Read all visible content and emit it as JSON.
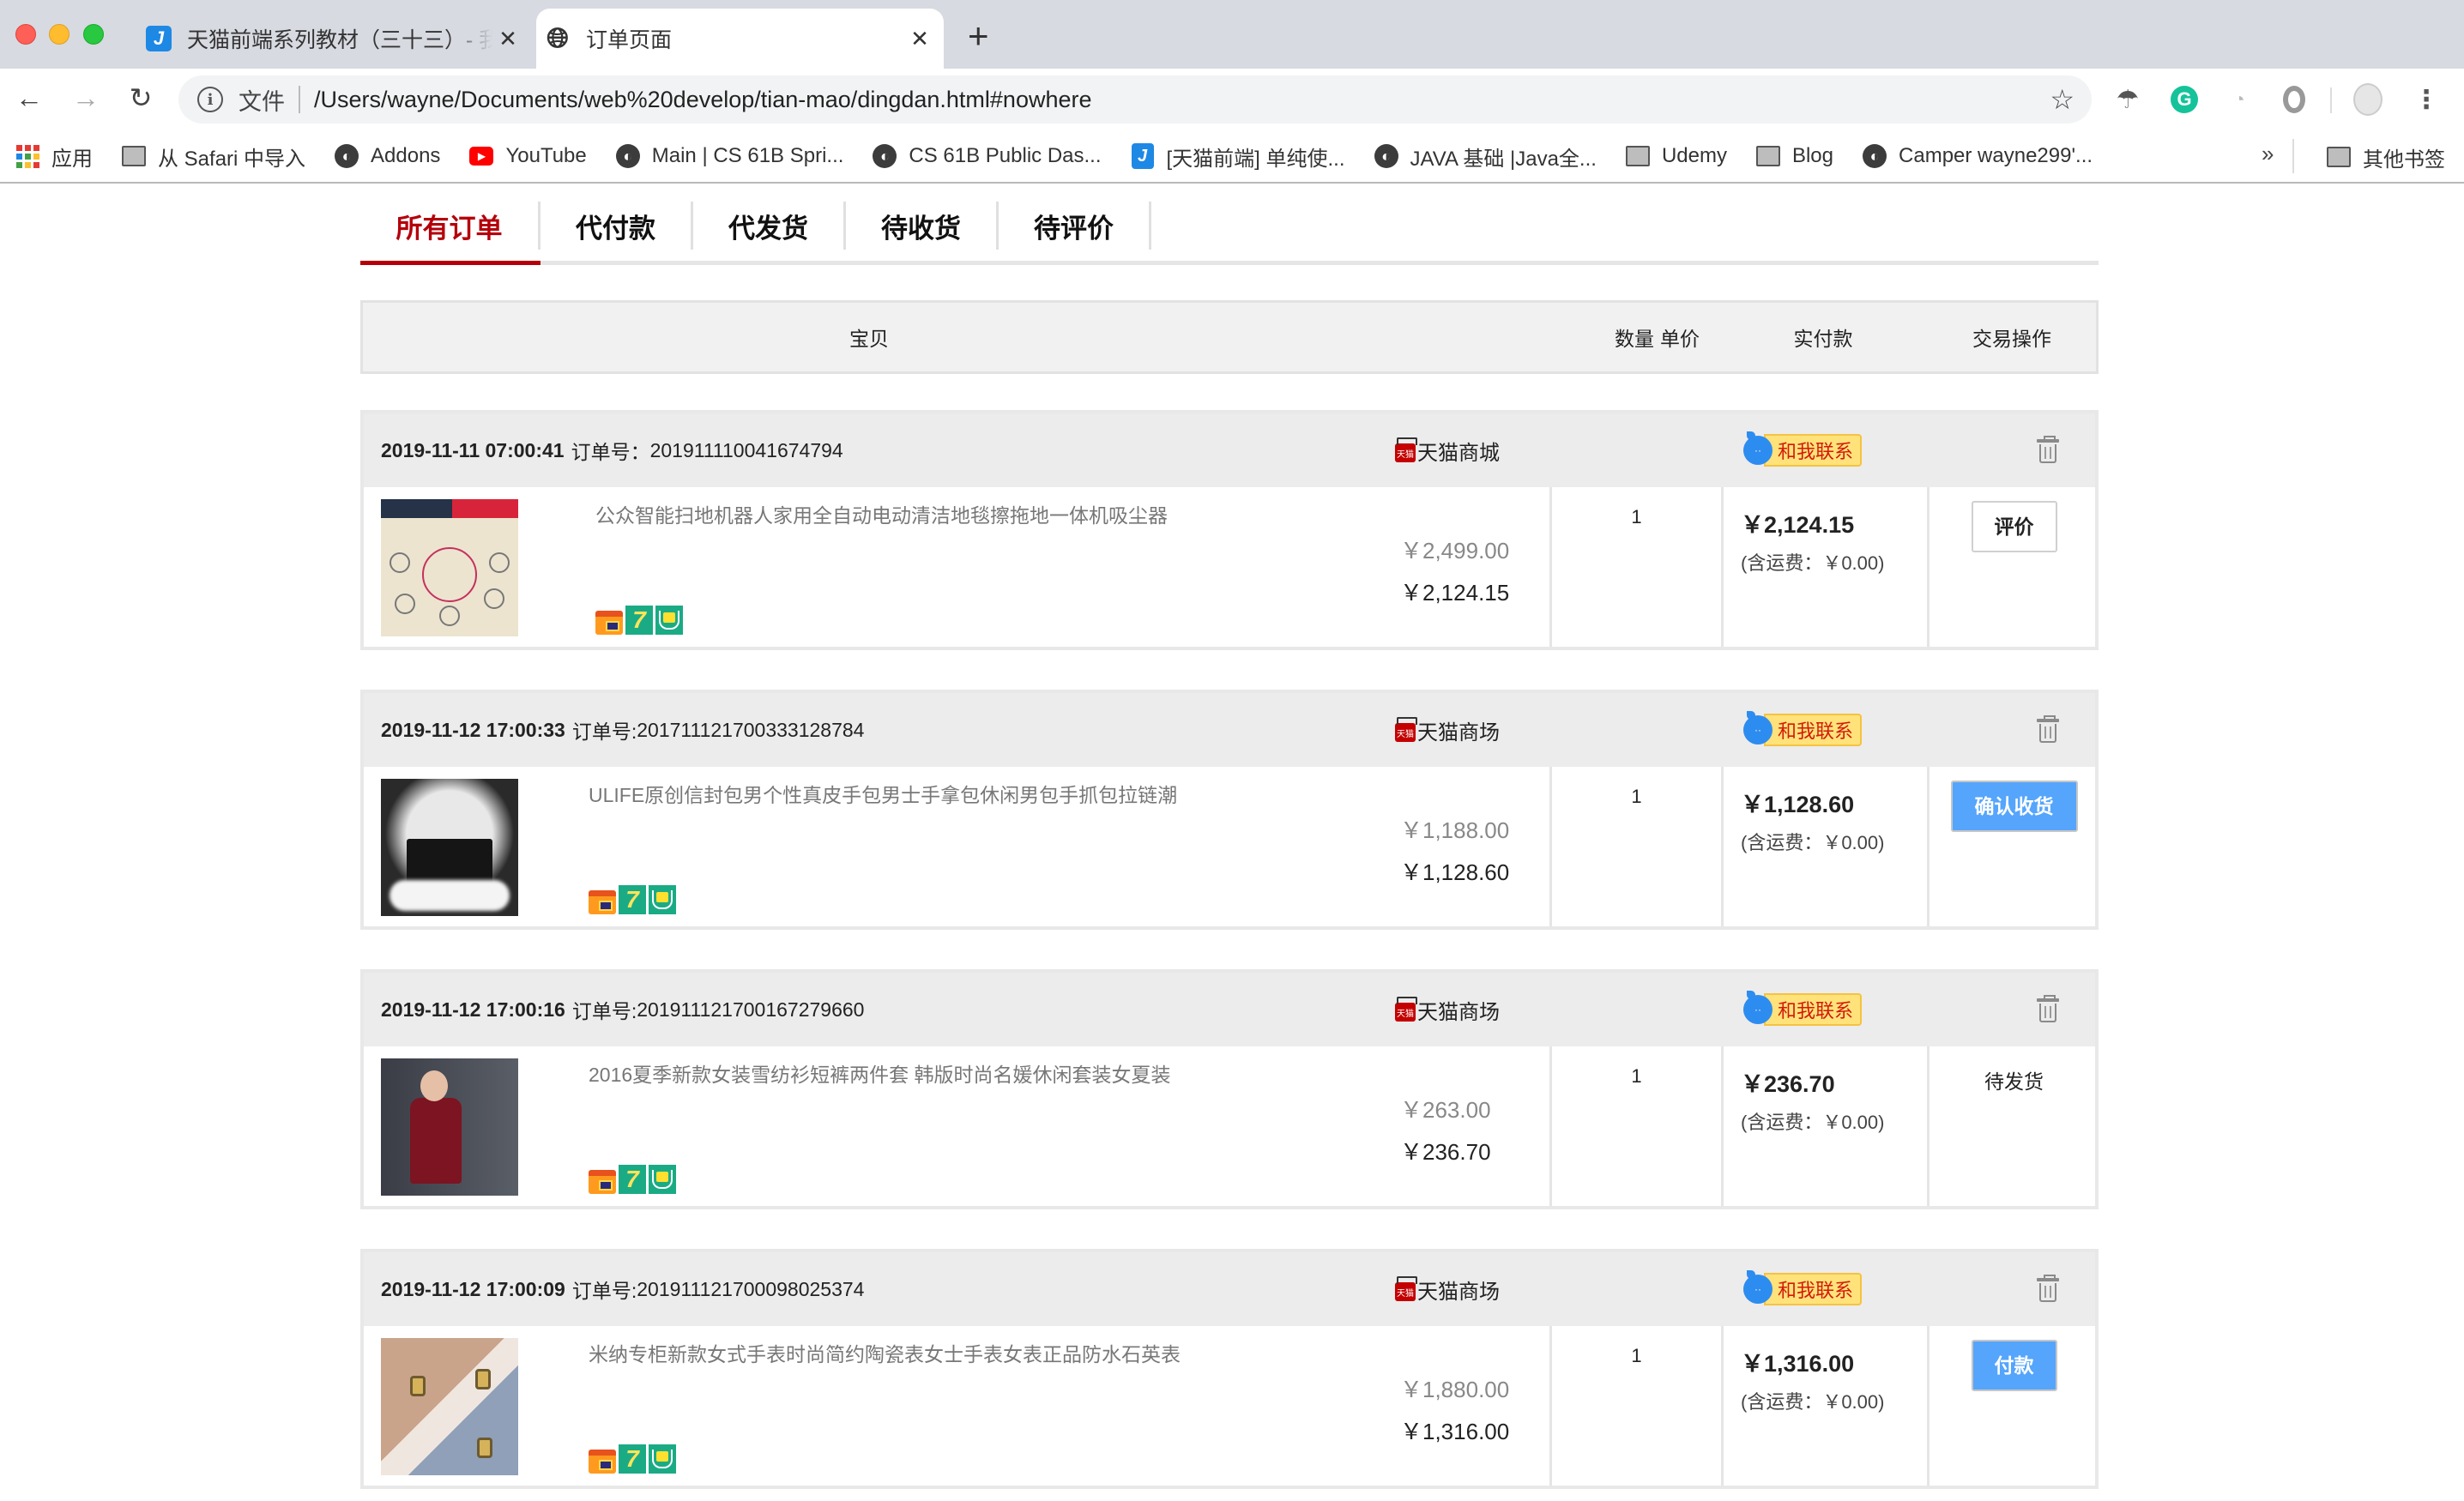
{
  "browser": {
    "tabs": [
      {
        "title": "天猫前端系列教材（三十三）- 我",
        "favicon": "j-icon",
        "active": false
      },
      {
        "title": "订单页面",
        "favicon": "globe-icon",
        "active": true
      }
    ],
    "close_glyph": "✕",
    "new_tab_glyph": "+",
    "nav": {
      "back": "←",
      "forward": "→",
      "reload": "↻"
    },
    "omnibox": {
      "scheme_label": "文件",
      "url": "/Users/wayne/Documents/web%20develop/tian-mao/dingdan.html#nowhere",
      "star_glyph": "☆"
    },
    "extensions": [
      "parachute-icon",
      "grammarly-icon",
      "speed-icon",
      "ring-icon"
    ],
    "menu_glyph": "⋮",
    "bookmarks": [
      {
        "label": "应用",
        "icon": "apps-icon"
      },
      {
        "label": "从 Safari 中导入",
        "icon": "folder-icon"
      },
      {
        "label": "Addons",
        "icon": "globe-icon"
      },
      {
        "label": "YouTube",
        "icon": "youtube-icon"
      },
      {
        "label": "Main | CS 61B Spri...",
        "icon": "globe-icon"
      },
      {
        "label": "CS 61B Public Das...",
        "icon": "globe-icon"
      },
      {
        "label": "[天猫前端] 单纯使...",
        "icon": "j-icon"
      },
      {
        "label": "JAVA 基础 |Java全...",
        "icon": "globe-icon"
      },
      {
        "label": "Udemy",
        "icon": "folder-icon"
      },
      {
        "label": "Blog",
        "icon": "folder-icon"
      },
      {
        "label": "Camper wayne299'...",
        "icon": "globe-icon"
      }
    ],
    "bookmarks_more": "»",
    "other_bookmarks": "其他书签"
  },
  "order_tabs": [
    {
      "label": "所有订单",
      "active": true
    },
    {
      "label": "代付款",
      "active": false
    },
    {
      "label": "代发货",
      "active": false
    },
    {
      "label": "待收货",
      "active": false
    },
    {
      "label": "待评价",
      "active": false
    }
  ],
  "table_header": {
    "item": "宝贝",
    "unit_price": "单价",
    "quantity": "数量",
    "paid": "实付款",
    "operation": "交易操作"
  },
  "contact_label": "和我联系",
  "orders": [
    {
      "datetime": "2019-11-11 07:00:41",
      "order_no_label": "订单号：",
      "order_no": "201911110041674794",
      "shop": "天猫商城",
      "product_title": "公众智能扫地机器人家用全自动电动清洁地毯擦拖地一体机吸尘器",
      "original_price": "￥2,499.00",
      "price": "￥2,124.15",
      "quantity": "1",
      "paid": "￥2,124.15",
      "shipping": "(含运费：￥0.00)",
      "action": {
        "type": "button",
        "style": "outline",
        "label": "评价"
      }
    },
    {
      "datetime": "2019-11-12 17:00:33",
      "order_no_label": "订单号:",
      "order_no": "20171112170033312878​4",
      "shop": "天猫商场",
      "product_title": "ULIFE原创信封包男个性真皮手包男士手拿包休闲男包手抓包拉链潮",
      "original_price": "￥1,188.00",
      "price": "￥1,128.60",
      "quantity": "1",
      "paid": "￥1,128.60",
      "shipping": "(含运费：￥0.00)",
      "action": {
        "type": "button",
        "style": "primary",
        "label": "确认收货"
      }
    },
    {
      "datetime": "2019-11-12 17:00:16",
      "order_no_label": "订单号:",
      "order_no": "201911121700167279660",
      "shop": "天猫商场",
      "product_title": "2016夏季新款女装雪纺衫短裤两件套 韩版时尚名媛休闲套装女夏装",
      "original_price": "￥263.00",
      "price": "￥236.70",
      "quantity": "1",
      "paid": "￥236.70",
      "shipping": "(含运费：￥0.00)",
      "action": {
        "type": "status",
        "label": "待发货"
      }
    },
    {
      "datetime": "2019-11-12 17:00:09",
      "order_no_label": "订单号:",
      "order_no": "201911121700098025374",
      "shop": "天猫商场",
      "product_title": "米纳专柜新款女式手表时尚简约陶瓷表女士手表女表正品防水石英表",
      "original_price": "￥1,880.00",
      "price": "￥1,316.00",
      "quantity": "1",
      "paid": "￥1,316.00",
      "shipping": "(含运费：￥0.00)",
      "action": {
        "type": "button",
        "style": "primary",
        "label": "付款"
      }
    }
  ],
  "colors": {
    "active_tab": "#b4000b",
    "primary_button": "#55a5fc",
    "contact_badge_bg": "#ffe27a",
    "contact_badge_text": "#d21a0a",
    "order_header_bg": "#ececec"
  }
}
